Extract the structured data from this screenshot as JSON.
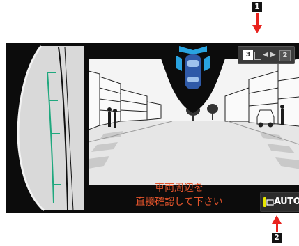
{
  "callouts": {
    "top": "1",
    "bottom": "2"
  },
  "warning": {
    "line1": "車両周辺を",
    "line2": "直接確認して下さい"
  },
  "auto_button": {
    "label": "AUTO"
  },
  "view_switch": {
    "left_number": "3",
    "right_number": "2"
  },
  "colors": {
    "guide": "#1fa87e",
    "warning": "#e5542b",
    "sensor": "#29a3e0",
    "car": "#2f5aa8"
  }
}
